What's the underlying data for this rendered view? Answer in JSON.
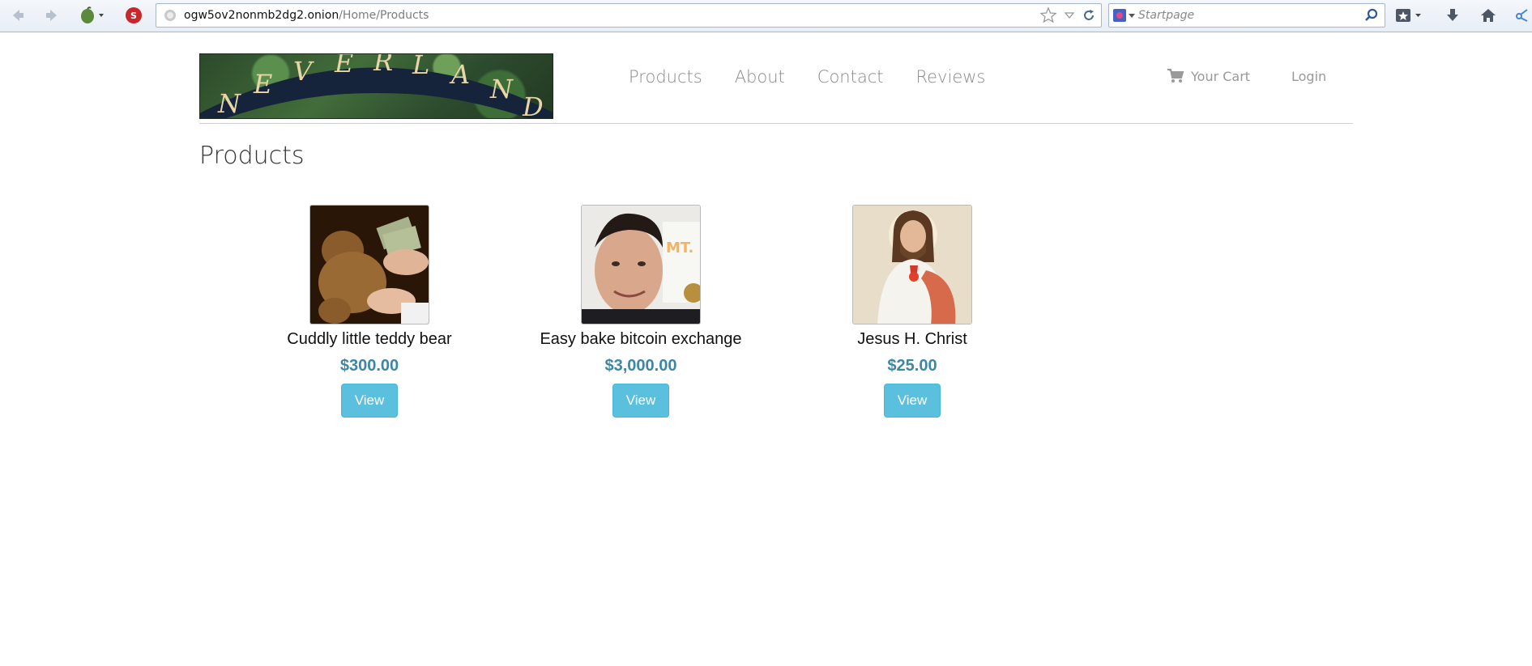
{
  "browser": {
    "url_host": "ogw5ov2nonmb2dg2.onion",
    "url_path": "/Home/Products",
    "search_placeholder": "Startpage"
  },
  "site": {
    "logo_text": "NEVERLAND",
    "nav": [
      {
        "label": "Products"
      },
      {
        "label": "About"
      },
      {
        "label": "Contact"
      },
      {
        "label": "Reviews"
      }
    ],
    "cart_label": "Your Cart",
    "login_label": "Login"
  },
  "page": {
    "title": "Products"
  },
  "products": [
    {
      "name": "Cuddly little teddy bear",
      "price": "$300.00",
      "button": "View",
      "image": "teddy-bear-with-cash"
    },
    {
      "name": "Easy bake bitcoin exchange",
      "price": "$3,000.00",
      "button": "View",
      "image": "man-holding-coin"
    },
    {
      "name": "Jesus H. Christ",
      "price": "$25.00",
      "button": "View",
      "image": "religious-painting"
    }
  ],
  "colors": {
    "price": "#3b87a4",
    "button": "#5bc0de",
    "nav_text": "#8a8a8a"
  }
}
